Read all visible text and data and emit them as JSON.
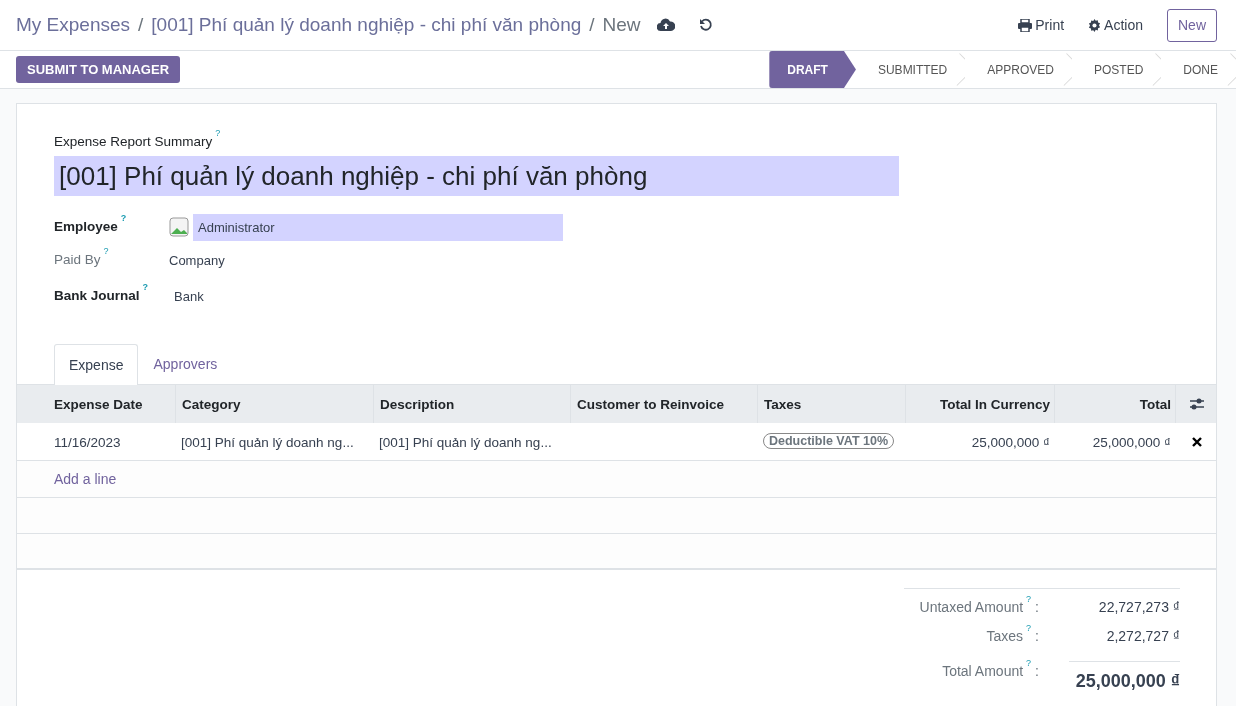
{
  "breadcrumbs": [
    {
      "label": "My Expenses",
      "separator": "/"
    },
    {
      "label": "[001] Phí quản lý doanh nghiệp - chi phí văn phòng",
      "separator": "/"
    },
    {
      "label": "New"
    }
  ],
  "toolbar": [
    {
      "label": "Print",
      "kind": "print"
    },
    {
      "label": "Action",
      "kind": "gear"
    }
  ],
  "new_button": "New",
  "submit_button": "SUBMIT TO MANAGER",
  "statuses": [
    {
      "label": "DRAFT",
      "selected": true
    },
    {
      "label": "SUBMITTED",
      "selected": false
    },
    {
      "label": "APPROVED",
      "selected": false
    },
    {
      "label": "POSTED",
      "selected": false
    },
    {
      "label": "DONE",
      "selected": false
    }
  ],
  "summary": {
    "label": "Expense Report Summary",
    "help": "?",
    "value": "[001] Phí quản lý doanh nghiệp - chi phí văn phòng"
  },
  "fields": [
    {
      "label": "Employee",
      "help": "?",
      "value": "Administrator",
      "kind": "avatar",
      "readonly": false
    },
    {
      "label": "Paid By",
      "help": "?",
      "value": "Company",
      "kind": "text",
      "readonly": true
    },
    {
      "label": "Bank Journal",
      "help": "?",
      "value": "Bank",
      "kind": "text",
      "readonly": false
    }
  ],
  "tabs": [
    {
      "label": "Expense",
      "selected": true
    },
    {
      "label": "Approvers",
      "selected": false
    }
  ],
  "table": {
    "columns": [
      {
        "label": "Expense Date"
      },
      {
        "label": "Category"
      },
      {
        "label": "Description"
      },
      {
        "label": "Customer to Reinvoice"
      },
      {
        "label": "Taxes"
      },
      {
        "label": "Total In Currency"
      },
      {
        "label": "Total"
      }
    ],
    "rows": [
      {
        "cells": [
          "11/16/2023",
          "[001] Phí quản lý doanh ng...",
          "[001] Phí quản lý doanh ng...",
          "",
          {
            "tag": "Deductible VAT 10%"
          },
          "25,000,000 ₫",
          "25,000,000 ₫"
        ]
      }
    ],
    "add_line": "Add a line"
  },
  "totals": [
    {
      "label": "Untaxed Amount",
      "help": "?",
      "colon": ":",
      "value": "22,727,273 ₫",
      "grand": false
    },
    {
      "label": "Taxes",
      "help": "?",
      "colon": ":",
      "value": "2,272,727 ₫",
      "grand": false
    },
    {
      "label": "Total Amount",
      "help": "?",
      "colon": ":",
      "value": "25,000,000 ₫",
      "grand": true
    }
  ]
}
